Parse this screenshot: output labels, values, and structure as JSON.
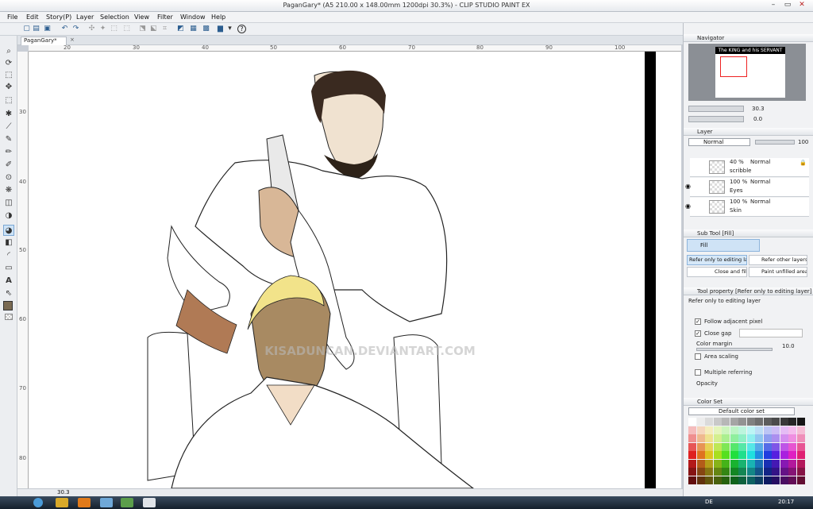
{
  "window": {
    "title": "PaganGary* (A5 210.00 x 148.00mm 1200dpi 30.3%) - CLIP STUDIO PAINT EX"
  },
  "menu": [
    "File",
    "Edit",
    "Story(P)",
    "Layer",
    "Selection",
    "View",
    "Filter",
    "Window",
    "Help"
  ],
  "document_tab": "PaganGary*",
  "ruler": {
    "h_ticks": [
      "20",
      "30",
      "40",
      "50",
      "60",
      "70",
      "80",
      "90",
      "100"
    ],
    "v_ticks": [
      "30",
      "40",
      "50",
      "60",
      "70",
      "80"
    ]
  },
  "status": {
    "zoom": "30.3"
  },
  "watermark": "KISADUNCAN.DEVIANTART.COM",
  "navigator": {
    "title": "Navigator",
    "preview_caption": "The KING and his SERVANT",
    "zoom_value": "30.3",
    "rotation_value": "0.0"
  },
  "layer_panel": {
    "title": "Layer",
    "blend_mode": "Normal",
    "opacity": "100",
    "layers": [
      {
        "opacity": "40 %",
        "mode": "Normal",
        "name": "scribble"
      },
      {
        "opacity": "100 %",
        "mode": "Normal",
        "name": "Eyes"
      },
      {
        "opacity": "100 %",
        "mode": "Normal",
        "name": "Skin"
      }
    ]
  },
  "subtool_panel": {
    "title": "Sub Tool [Fill]",
    "tab": "Fill",
    "items": [
      "Refer only to editing layer",
      "Refer other layers",
      "Close and fill",
      "Paint unfilled area"
    ]
  },
  "tool_property": {
    "title": "Tool property [Refer only to editing layer]",
    "subtitle": "Refer only to editing layer",
    "follow_adjacent": "Follow adjacent pixel",
    "close_gap": "Close gap",
    "color_margin": "Color margin",
    "color_margin_value": "10.0",
    "area_scaling": "Area scaling",
    "multiple_referring": "Multiple referring",
    "opacity_label": "Opacity"
  },
  "color_set": {
    "title": "Color Set",
    "set_name": "Default color set"
  },
  "taskbar": {
    "language": "DE",
    "time": "20:17"
  }
}
